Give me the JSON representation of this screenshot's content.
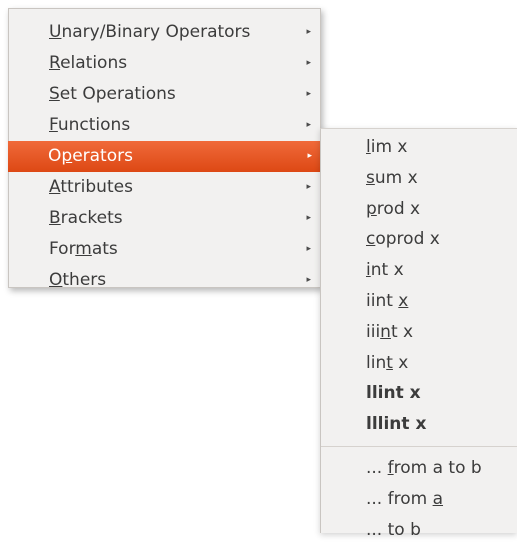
{
  "main_menu": {
    "items": [
      {
        "pre": "",
        "mn": "U",
        "post": "nary/Binary Operators"
      },
      {
        "pre": "",
        "mn": "R",
        "post": "elations"
      },
      {
        "pre": "",
        "mn": "S",
        "post": "et Operations"
      },
      {
        "pre": "",
        "mn": "F",
        "post": "unctions"
      },
      {
        "pre": "O",
        "mn": "p",
        "post": "erators"
      },
      {
        "pre": "",
        "mn": "A",
        "post": "ttributes"
      },
      {
        "pre": "",
        "mn": "B",
        "post": "rackets"
      },
      {
        "pre": "For",
        "mn": "m",
        "post": "ats"
      },
      {
        "pre": "",
        "mn": "O",
        "post": "thers"
      }
    ],
    "arrow": "▸",
    "active_item": "Operators"
  },
  "sub_menu": {
    "items": [
      {
        "pre": "",
        "mn": "l",
        "post": "im x"
      },
      {
        "pre": "",
        "mn": "s",
        "post": "um x"
      },
      {
        "pre": "",
        "mn": "p",
        "post": "rod x"
      },
      {
        "pre": "",
        "mn": "c",
        "post": "oprod x"
      },
      {
        "pre": "",
        "mn": "i",
        "post": "nt x"
      },
      {
        "pre": "iint ",
        "mn": "x",
        "post": ""
      },
      {
        "pre": "iii",
        "mn": "n",
        "post": "t x"
      },
      {
        "pre": "lin",
        "mn": "t",
        "post": " x"
      },
      {
        "pre": "llint x",
        "mn": "",
        "post": ""
      },
      {
        "pre": "lllint x",
        "mn": "",
        "post": ""
      },
      {
        "pre": "... ",
        "mn": "f",
        "post": "rom a to b"
      },
      {
        "pre": "... from ",
        "mn": "a",
        "post": ""
      },
      {
        "pre": "... to b",
        "mn": "",
        "post": ""
      }
    ]
  },
  "colors": {
    "menu_bg": "#f2f1f0",
    "highlight": "#dd4814",
    "text": "#3c3c3c"
  }
}
